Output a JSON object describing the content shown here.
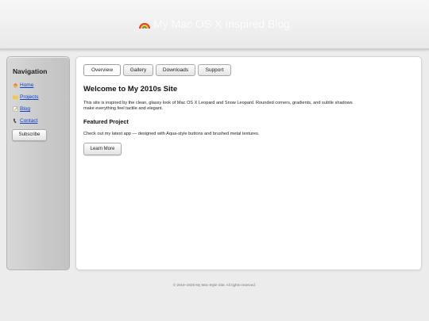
{
  "header": {
    "title": "My Mac OS X Inspired Blog",
    "icon": "rainbow-icon"
  },
  "sidebar": {
    "title": "Navigation",
    "items": [
      {
        "label": "Home",
        "icon": "home-icon"
      },
      {
        "label": "Projects",
        "icon": "folder-icon"
      },
      {
        "label": "Blog",
        "icon": "memo-icon"
      },
      {
        "label": "Contact",
        "icon": "phone-icon"
      }
    ],
    "subscribe_label": "Subscribe"
  },
  "tabs": [
    "Overview",
    "Gallery",
    "Downloads",
    "Support"
  ],
  "main": {
    "heading": "Welcome to My 2010s Site",
    "intro_line1": "This site is inspired by the clean, glassy look of Mac OS X Leopard and Snow Leopard. Rounded corners, gradients, and subtle shadows",
    "intro_line2": "make everything feel tactile and elegant.",
    "featured_heading": "Featured Project",
    "featured_text": "Check out my latest app — designed with Aqua-style buttons and brushed metal textures.",
    "learn_more_label": "Learn More"
  },
  "footer": {
    "text": "© 2010–2025 My Mac-Style Site. All rights reserved."
  },
  "colors": {
    "link": "#0b3fd1",
    "page_bg": "#ececec",
    "header_text": "#ffffff"
  }
}
